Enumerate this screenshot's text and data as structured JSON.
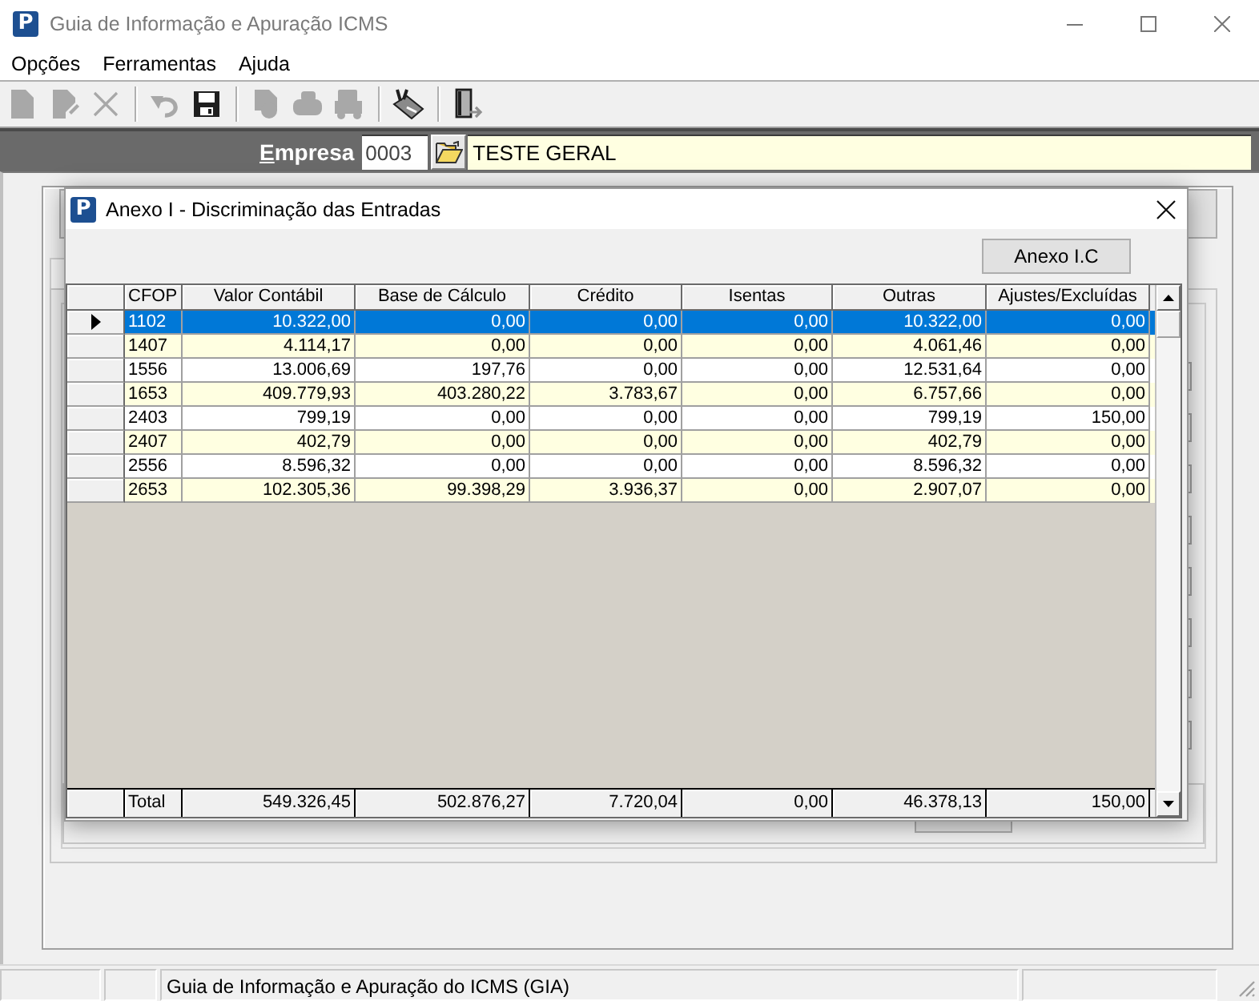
{
  "window": {
    "logo": "P",
    "title": "Guia de Informação e Apuração ICMS"
  },
  "menu": [
    "Opções",
    "Ferramentas",
    "Ajuda"
  ],
  "toolbar": [
    {
      "kind": "new",
      "disabled": true
    },
    {
      "kind": "edit",
      "disabled": true
    },
    {
      "kind": "delete",
      "disabled": true
    },
    {
      "kind": "separator"
    },
    {
      "kind": "undo",
      "disabled": true
    },
    {
      "kind": "save",
      "disabled": false
    },
    {
      "kind": "separator"
    },
    {
      "kind": "preview",
      "disabled": true
    },
    {
      "kind": "print",
      "disabled": true
    },
    {
      "kind": "truck",
      "disabled": true
    },
    {
      "kind": "separator"
    },
    {
      "kind": "tool",
      "disabled": false
    },
    {
      "kind": "separator"
    },
    {
      "kind": "exit",
      "disabled": false
    }
  ],
  "company": {
    "label": "Empresa",
    "code": "0003",
    "name": "TESTE GERAL"
  },
  "dialog": {
    "logo": "P",
    "title": "Anexo I - Discriminação das Entradas",
    "buttons": [
      "Anexo I.C"
    ],
    "table": {
      "columns": [
        "CFOP",
        "Valor Contábil",
        "Base de Cálculo",
        "Crédito",
        "Isentas",
        "Outras",
        "Ajustes/Excluídas"
      ],
      "rows": [
        {
          "selected": true,
          "cells": [
            "1102",
            "10.322,00",
            "0,00",
            "0,00",
            "0,00",
            "10.322,00",
            "0,00"
          ]
        },
        {
          "selected": false,
          "cells": [
            "1407",
            "4.114,17",
            "0,00",
            "0,00",
            "0,00",
            "4.061,46",
            "0,00"
          ]
        },
        {
          "selected": false,
          "cells": [
            "1556",
            "13.006,69",
            "197,76",
            "0,00",
            "0,00",
            "12.531,64",
            "0,00"
          ]
        },
        {
          "selected": false,
          "cells": [
            "1653",
            "409.779,93",
            "403.280,22",
            "3.783,67",
            "0,00",
            "6.757,66",
            "0,00"
          ]
        },
        {
          "selected": false,
          "cells": [
            "2403",
            "799,19",
            "0,00",
            "0,00",
            "0,00",
            "799,19",
            "150,00"
          ]
        },
        {
          "selected": false,
          "cells": [
            "2407",
            "402,79",
            "0,00",
            "0,00",
            "0,00",
            "402,79",
            "0,00"
          ]
        },
        {
          "selected": false,
          "cells": [
            "2556",
            "8.596,32",
            "0,00",
            "0,00",
            "0,00",
            "8.596,32",
            "0,00"
          ]
        },
        {
          "selected": false,
          "cells": [
            "2653",
            "102.305,36",
            "99.398,29",
            "3.936,37",
            "0,00",
            "2.907,07",
            "0,00"
          ]
        }
      ],
      "total": [
        "Total",
        "549.326,45",
        "502.876,27",
        "7.720,04",
        "0,00",
        "46.378,13",
        "150,00"
      ]
    }
  },
  "status_bar": {
    "text": "Guia de Informação e Apuração do ICMS (GIA)"
  }
}
